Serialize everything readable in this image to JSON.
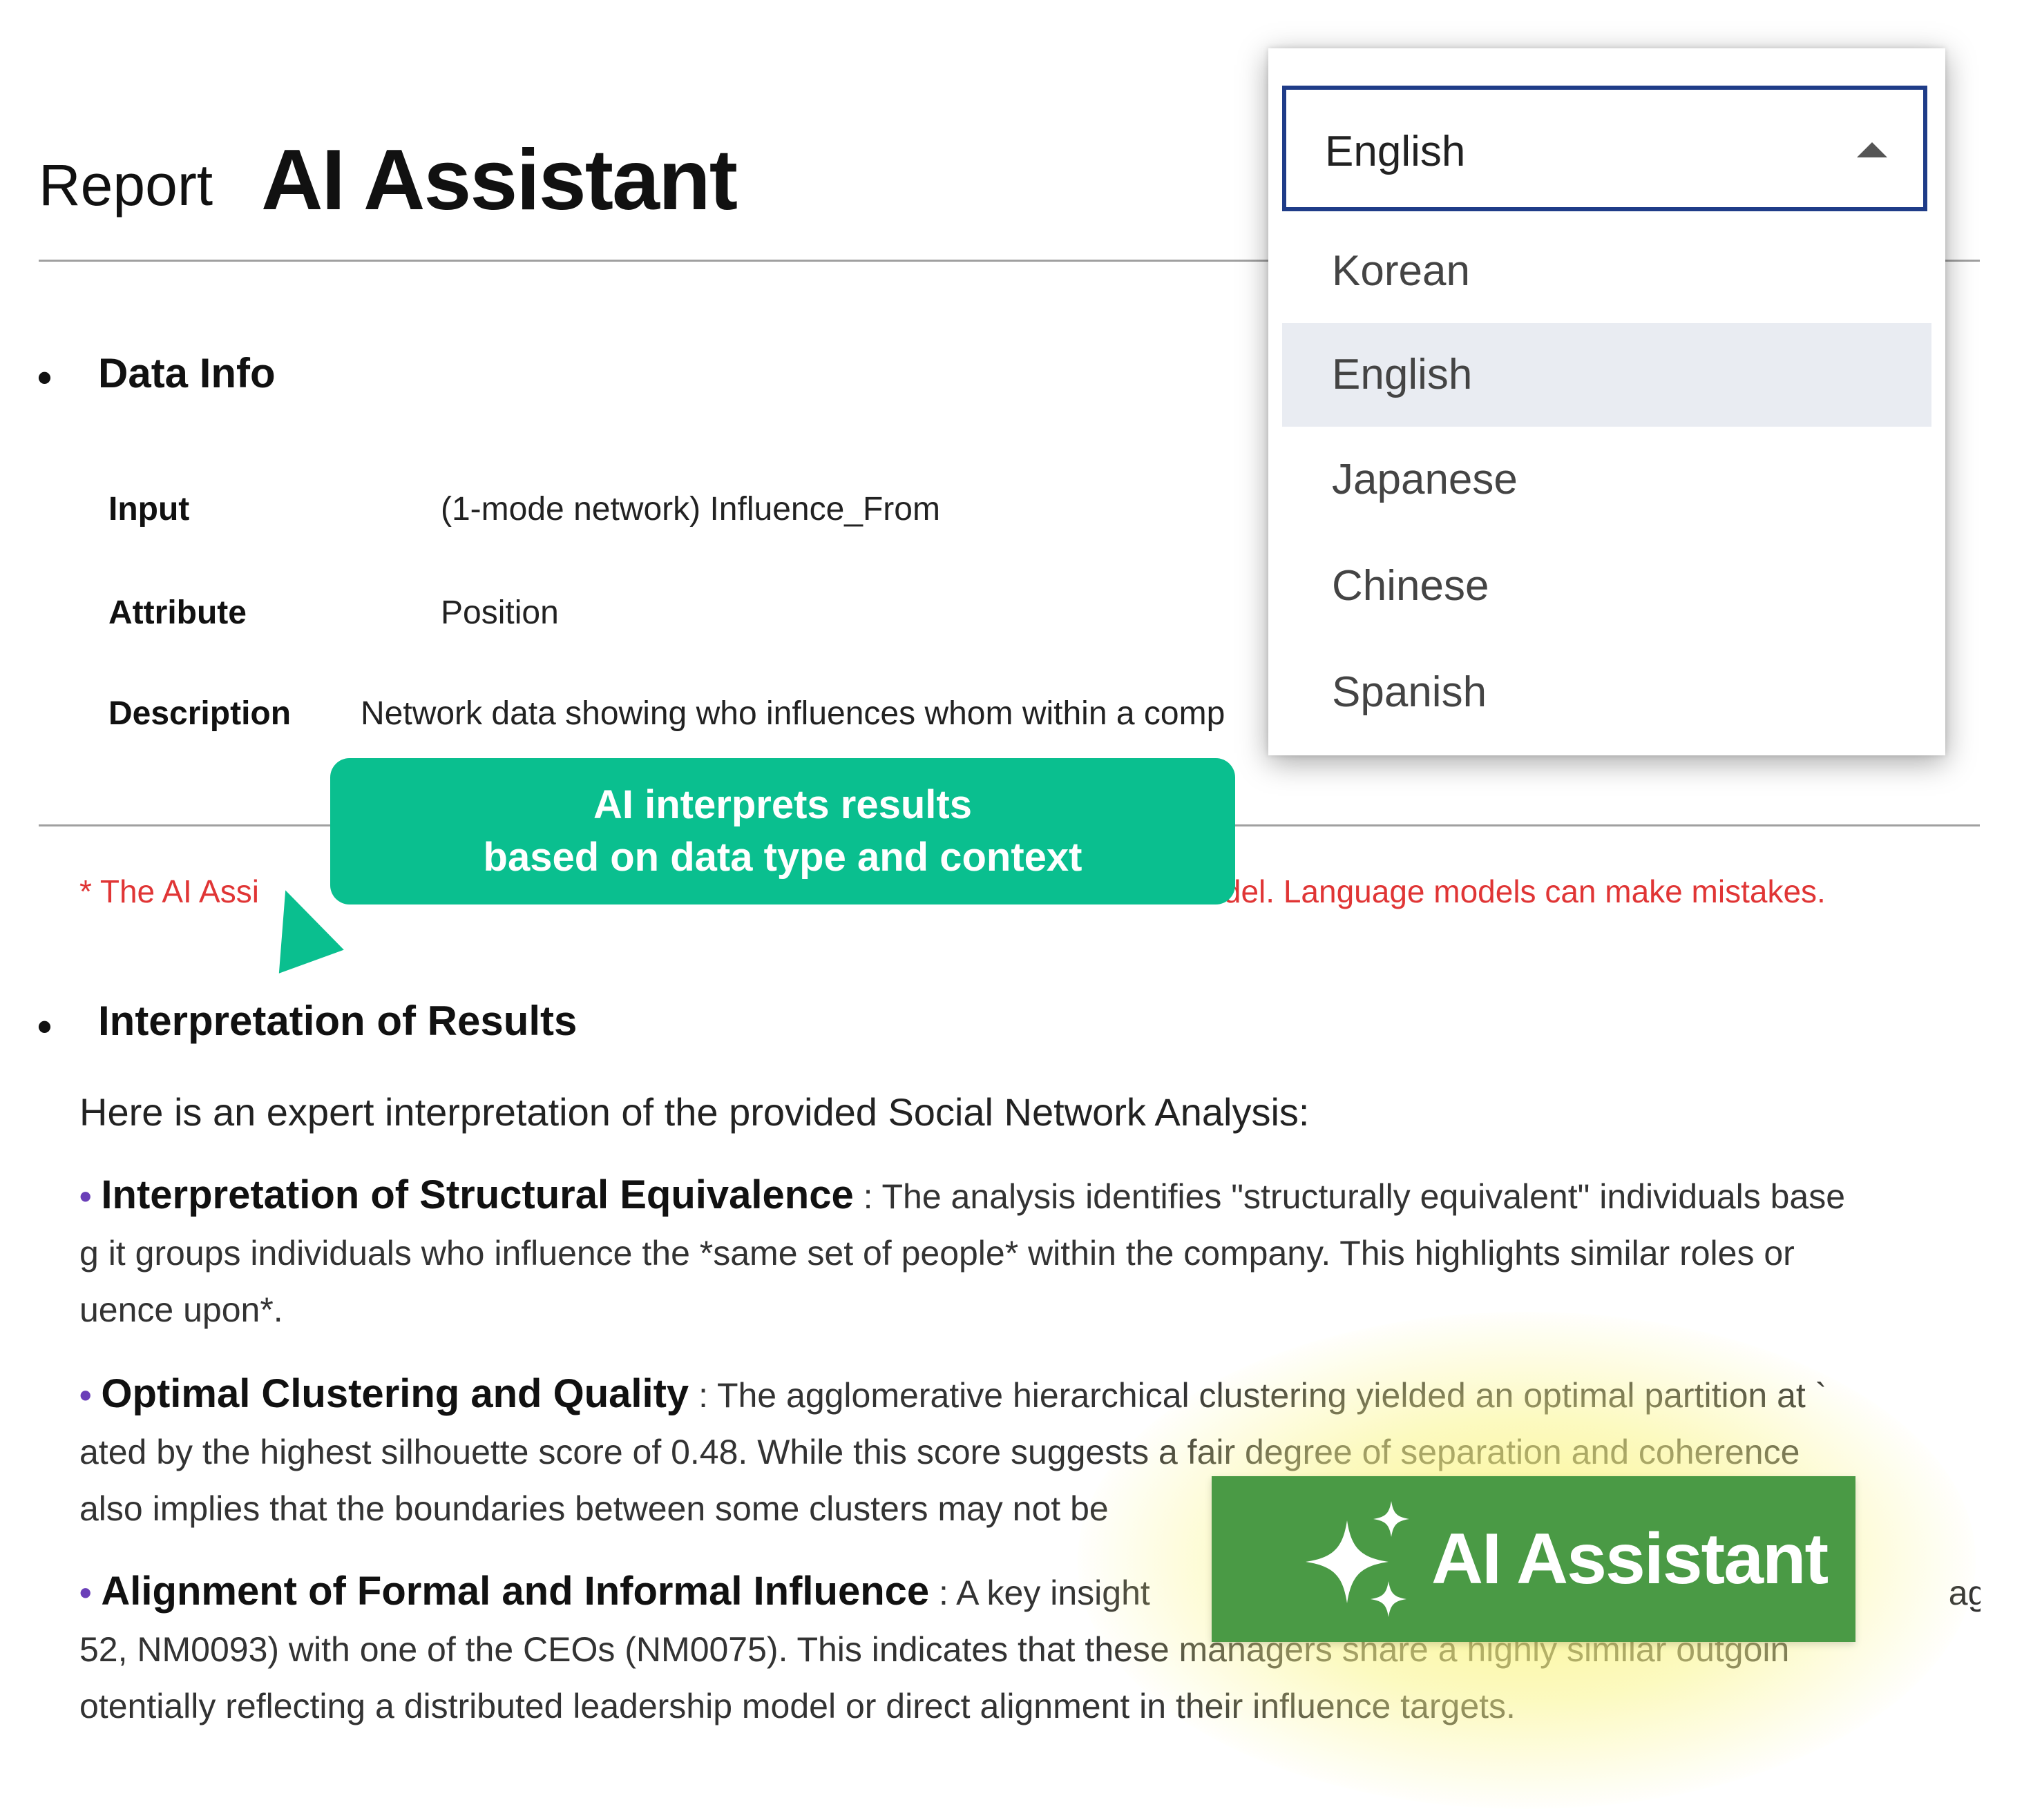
{
  "header": {
    "report_label": "Report",
    "title": "AI Assistant"
  },
  "data_info": {
    "section_title": "Data Info",
    "fields": [
      {
        "label": "Input",
        "value": "(1-mode network) Influence_From"
      },
      {
        "label": "Attribute",
        "value": "Position"
      },
      {
        "label": "Description",
        "value": "Network data showing who influences whom within a comp"
      }
    ]
  },
  "language_dropdown": {
    "selected": "English",
    "options": [
      "Korean",
      "English",
      "Japanese",
      "Chinese",
      "Spanish"
    ],
    "highlighted": "English"
  },
  "callout": {
    "line1": "AI interprets results",
    "line2": "based on data type and context"
  },
  "warning": {
    "prefix": "* The AI Assi",
    "suffix": "model. Language models can make mistakes."
  },
  "interpretation": {
    "section_title": "Interpretation of Results",
    "intro": "Here is an expert interpretation of the provided Social Network Analysis:",
    "items": [
      {
        "heading": "Interpretation of Structural Equivalence",
        "line1": " : The analysis identifies \"structurally equivalent\" individuals base",
        "line2": "g it groups individuals who influence the *same set of people* within the company. This highlights similar roles or",
        "line3": "uence upon*."
      },
      {
        "heading": "Optimal Clustering and Quality",
        "line1": " : The agglomerative hierarchical clustering yielded an optimal partition at `",
        "line2": "ated by the highest silhouette score of 0.48. While this score suggests a fair degree of separation and coherence",
        "line3": "also implies that the boundaries between some clusters may not be"
      },
      {
        "heading": "Alignment of Formal and Informal Influence",
        "line1": " : A key insight",
        "line1_tail": "agers\" (",
        "line2": "52, NM0093) with one of the CEOs (NM0075). This indicates that these managers share a highly similar outgoin",
        "line3": "otentially reflecting a distributed leadership model or direct alignment in their influence targets."
      }
    ]
  },
  "badge": {
    "label": "AI Assistant",
    "icon": "sparkle-icon"
  },
  "colors": {
    "callout": "#0abf8f",
    "badge": "#4a9a45",
    "warning": "#e03535",
    "select_border": "#1f3c88",
    "bullet_dot": "#6a3fb8"
  }
}
